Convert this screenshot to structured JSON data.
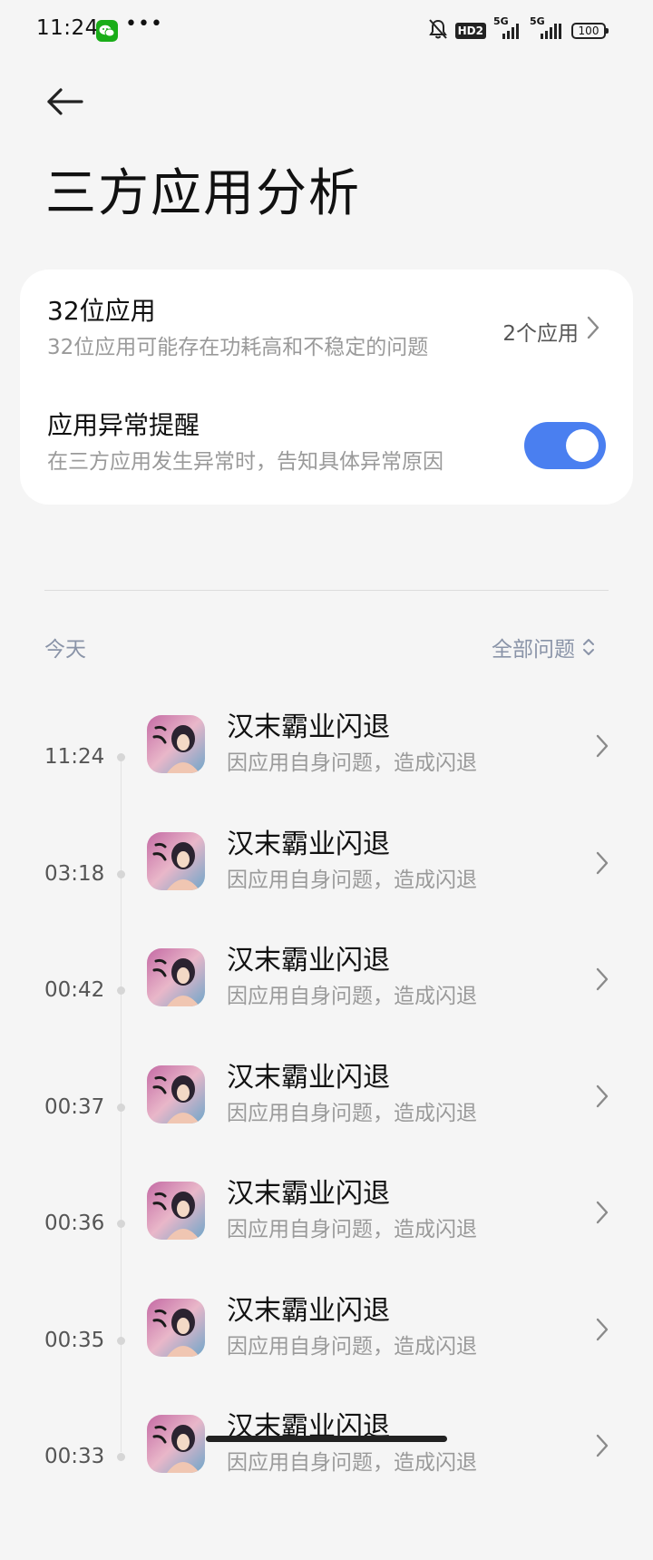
{
  "status_bar": {
    "time": "11:24",
    "notification_icon": "wechat-icon",
    "more": "•••",
    "hd_label": "HD2",
    "network_1": "5G",
    "network_2": "5G",
    "battery": "100"
  },
  "header": {
    "back_icon": "arrow-left-icon",
    "title": "三方应用分析"
  },
  "settings": {
    "app32": {
      "title": "32位应用",
      "subtitle": "32位应用可能存在功耗高和不稳定的问题",
      "value": "2个应用"
    },
    "abnormal_reminder": {
      "title": "应用异常提醒",
      "subtitle": "在三方应用发生异常时，告知具体异常原因",
      "enabled": true
    }
  },
  "log": {
    "date_label": "今天",
    "filter_label": "全部问题",
    "events": [
      {
        "time": "11:24",
        "title": "汉末霸业闪退",
        "subtitle": "因应用自身问题，造成闪退"
      },
      {
        "time": "03:18",
        "title": "汉末霸业闪退",
        "subtitle": "因应用自身问题，造成闪退"
      },
      {
        "time": "00:42",
        "title": "汉末霸业闪退",
        "subtitle": "因应用自身问题，造成闪退"
      },
      {
        "time": "00:37",
        "title": "汉末霸业闪退",
        "subtitle": "因应用自身问题，造成闪退"
      },
      {
        "time": "00:36",
        "title": "汉末霸业闪退",
        "subtitle": "因应用自身问题，造成闪退"
      },
      {
        "time": "00:35",
        "title": "汉末霸业闪退",
        "subtitle": "因应用自身问题，造成闪退"
      },
      {
        "time": "00:33",
        "title": "汉末霸业闪退",
        "subtitle": "因应用自身问题，造成闪退"
      }
    ]
  },
  "colors": {
    "background": "#f5f5f5",
    "card": "#ffffff",
    "accent": "#4a7ff0",
    "secondary_text": "#9a9a9a",
    "label_blue_grey": "#8a94a8"
  }
}
